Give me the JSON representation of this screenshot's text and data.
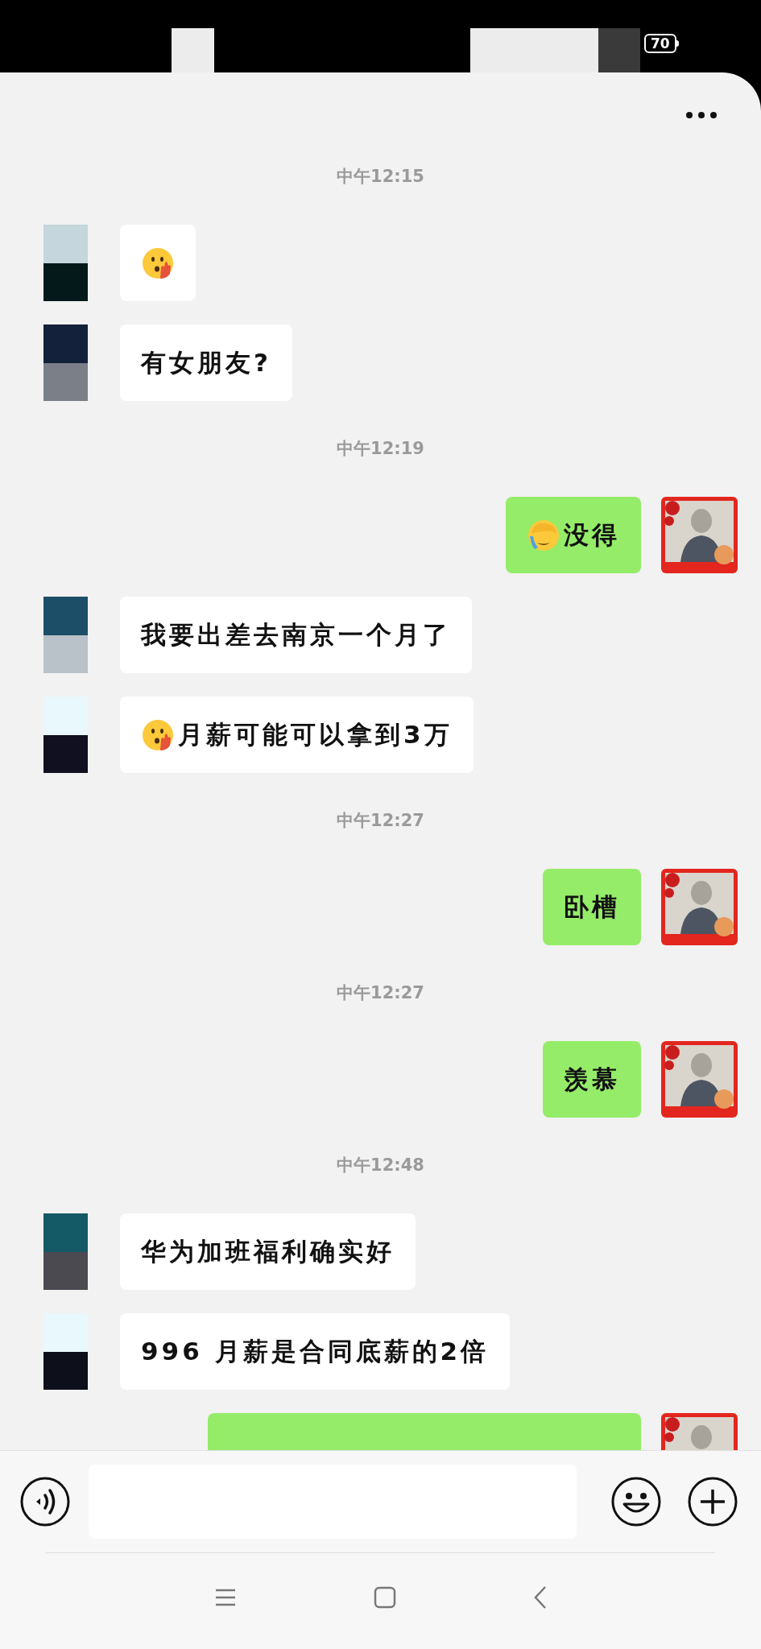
{
  "status_bar": {
    "battery": "70"
  },
  "messages": [
    {
      "kind": "time",
      "text": "中午12:15"
    },
    {
      "kind": "received",
      "emoji": {
        "kind": "hand-over-mouth"
      }
    },
    {
      "kind": "received",
      "text": "有女朋友?"
    },
    {
      "kind": "time",
      "text": "中午12:19"
    },
    {
      "kind": "sent",
      "emoji": {
        "kind": "facepalm"
      },
      "text": "没得"
    },
    {
      "kind": "received",
      "text": "我要出差去南京一个月了"
    },
    {
      "kind": "received",
      "emoji": {
        "kind": "hand-over-mouth"
      },
      "text": "月薪可能可以拿到3万"
    },
    {
      "kind": "time",
      "text": "中午12:27"
    },
    {
      "kind": "sent",
      "text": "卧槽"
    },
    {
      "kind": "time",
      "text": "中午12:27"
    },
    {
      "kind": "sent",
      "text": "羡慕"
    },
    {
      "kind": "time",
      "text": "中午12:48"
    },
    {
      "kind": "received",
      "text": "华为加班福利确实好"
    },
    {
      "kind": "received",
      "text": "996 月薪是合同底薪的2倍"
    },
    {
      "kind": "sent"
    }
  ]
}
